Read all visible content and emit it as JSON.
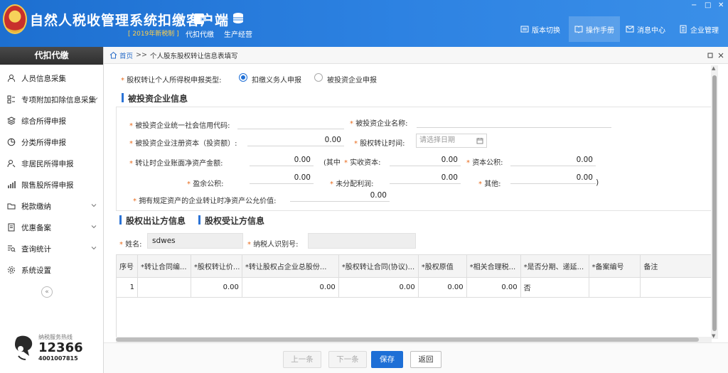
{
  "app": {
    "title": "自然人税收管理系统扣缴客户端",
    "subtitle": "[ 2019年新税制 ]",
    "modules": [
      {
        "label": "代扣代缴",
        "icon": "wallet-icon"
      },
      {
        "label": "生产经营",
        "icon": "coins-icon"
      }
    ],
    "nav": [
      {
        "label": "版本切换",
        "icon": "switch-icon"
      },
      {
        "label": "操作手册",
        "icon": "manual-icon"
      },
      {
        "label": "消息中心",
        "icon": "mail-icon"
      },
      {
        "label": "企业管理",
        "icon": "building-icon"
      }
    ],
    "window_controls": [
      "−",
      "□",
      "✕"
    ]
  },
  "sidebar": {
    "header": "代扣代缴",
    "items": [
      {
        "label": "人员信息采集",
        "icon": "person-icon",
        "has_children": false
      },
      {
        "label": "专项附加扣除信息采集",
        "icon": "grid-icon",
        "has_children": true
      },
      {
        "label": "综合所得申报",
        "icon": "layers-icon",
        "has_children": false
      },
      {
        "label": "分类所得申报",
        "icon": "pie-icon",
        "has_children": false
      },
      {
        "label": "非居民所得申报",
        "icon": "user-outline-icon",
        "has_children": false
      },
      {
        "label": "限售股所得申报",
        "icon": "bar-chart-icon",
        "has_children": false
      },
      {
        "label": "税款缴纳",
        "icon": "folder-icon",
        "has_children": true
      },
      {
        "label": "优惠备案",
        "icon": "document-icon",
        "has_children": true
      },
      {
        "label": "查询统计",
        "icon": "query-icon",
        "has_children": true
      },
      {
        "label": "系统设置",
        "icon": "gear-icon",
        "has_children": false
      }
    ],
    "collapse_symbol": "«",
    "hotline": {
      "label": "纳税服务热线",
      "number": "12366",
      "number2": "4001007815"
    }
  },
  "breadcrumb": {
    "home": "首页",
    "separator": ">>",
    "current": "个人股东股权转让信息表填写"
  },
  "form": {
    "declare_type_label": "股权转让个人所得税申报类型:",
    "declare_options": [
      {
        "label": "扣缴义务人申报",
        "selected": true
      },
      {
        "label": "被投资企业申报",
        "selected": false
      }
    ],
    "invested_section_title": "被投资企业信息",
    "invested": {
      "credit_code_label": "被投资企业统一社会信用代码:",
      "credit_code_value": "",
      "company_name_label": "被投资企业名称:",
      "company_name_value": "",
      "registered_capital_label": "被投资企业注册资本（投资额）:",
      "registered_capital_value": "0.00",
      "transfer_time_label": "股权转让时间:",
      "transfer_time_placeholder": "请选择日期",
      "net_assets_label": "转让时企业账面净资产金额:",
      "net_assets_value": "0.00",
      "paid_capital_prefix": "(其中",
      "paid_capital_label": "实收资本:",
      "paid_capital_value": "0.00",
      "capital_reserve_label": "资本公积:",
      "capital_reserve_value": "0.00",
      "surplus_reserve_label": "盈余公积:",
      "surplus_reserve_value": "0.00",
      "undistributed_label": "未分配利润:",
      "undistributed_value": "0.00",
      "other_label": "其他:",
      "other_value": "0.00",
      "close_paren": ")",
      "fair_value_label": "拥有规定资产的企业转让时净资产公允价值:",
      "fair_value_value": "0.00"
    },
    "transferor_tab": "股权出让方信息",
    "transferee_tab": "股权受让方信息",
    "name_label": "姓名:",
    "name_value": "sdwes",
    "taxpayer_id_label": "纳税人识别号:",
    "taxpayer_id_value": ""
  },
  "table": {
    "headers": [
      "序号",
      "*转让合同编...",
      "*股权转让价...",
      "*转让股权占企业总股份...",
      "*股权转让合同(协议)...",
      "*股权原值",
      "*相关合理税...",
      "*是否分期、递延...",
      "*备案编号",
      "备注"
    ],
    "rows": [
      [
        "1",
        "",
        "0.00",
        "0.00",
        "0.00",
        "0.00",
        "0.00",
        "否",
        "",
        ""
      ]
    ]
  },
  "footer": {
    "prev": "上一条",
    "next": "下一条",
    "save": "保存",
    "back": "返回"
  },
  "colors": {
    "header_blue": "#2d82e2",
    "primary_button": "#1e6fd6",
    "required_star": "#e86a1c"
  }
}
